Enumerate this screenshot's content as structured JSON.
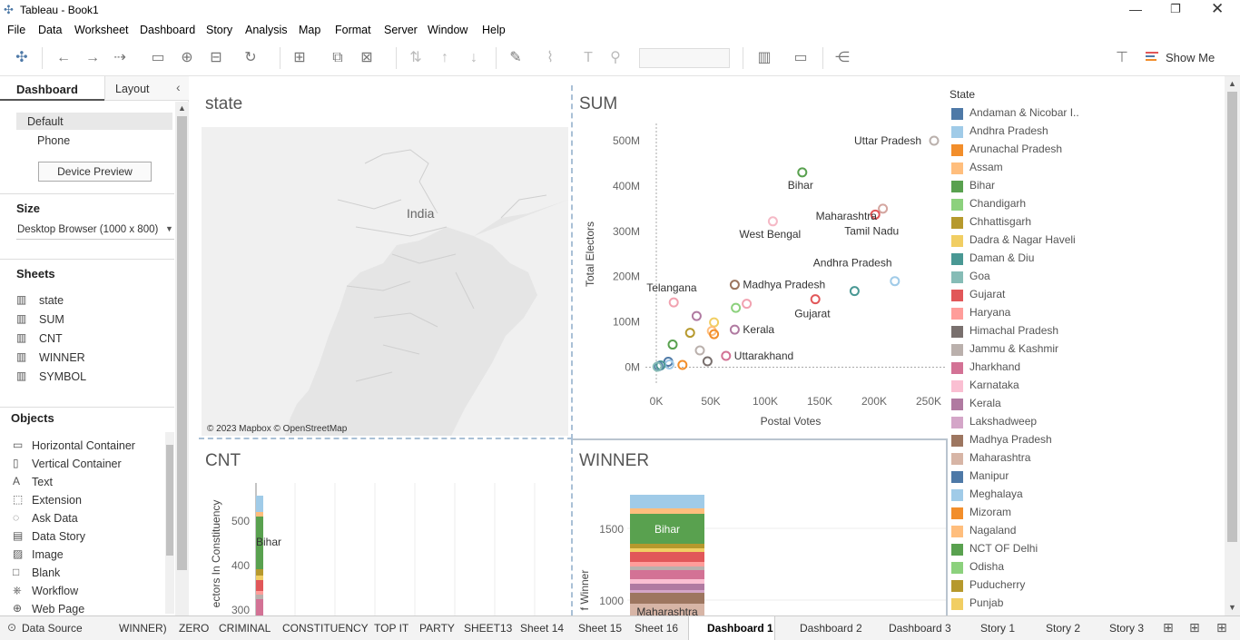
{
  "window": {
    "title": "Tableau - Book1"
  },
  "menu": [
    "File",
    "Data",
    "Worksheet",
    "Dashboard",
    "Story",
    "Analysis",
    "Map",
    "Format",
    "Server",
    "Window",
    "Help"
  ],
  "toolbar": {
    "show_me": "Show Me"
  },
  "left_panel": {
    "tabs": {
      "dashboard": "Dashboard",
      "layout": "Layout"
    },
    "device": {
      "default": "Default",
      "phone": "Phone",
      "preview_button": "Device Preview"
    },
    "size": {
      "heading": "Size",
      "value": "Desktop Browser (1000 x 800)"
    },
    "sheets": {
      "heading": "Sheets",
      "items": [
        "state",
        "SUM",
        "CNT",
        "WINNER",
        "SYMBOL"
      ]
    },
    "objects": {
      "heading": "Objects",
      "items": [
        "Horizontal Container",
        "Vertical Container",
        "Text",
        "Extension",
        "Ask Data",
        "Data Story",
        "Image",
        "Blank",
        "Workflow",
        "Web Page"
      ]
    }
  },
  "panes": {
    "map": {
      "title": "state",
      "label": "India",
      "credit": "© 2023 Mapbox © OpenStreetMap"
    },
    "sum": {
      "title": "SUM"
    },
    "cnt": {
      "title": "CNT",
      "ylabel": "ectors In Constituency",
      "yticks": [
        "500",
        "400",
        "300"
      ],
      "bar_label": "Bihar"
    },
    "winner": {
      "title": "WINNER",
      "ylabel": "f Winner",
      "yticks": [
        "1500",
        "1000"
      ],
      "bar_labels": [
        "Bihar",
        "Maharashtra"
      ]
    }
  },
  "chart_data": {
    "type": "scatter",
    "xlabel": "Postal Votes",
    "ylabel": "Total Electors",
    "xticks": [
      "0K",
      "50K",
      "100K",
      "150K",
      "200K",
      "250K"
    ],
    "yticks": [
      "0M",
      "100M",
      "200M",
      "300M",
      "400M",
      "500M"
    ],
    "xlim": [
      -10000,
      265000
    ],
    "ylim": [
      -15000000,
      530000000
    ],
    "points": [
      {
        "label": "Uttar Pradesh",
        "x": 255000,
        "y": 500000000,
        "color": "#bab0ac"
      },
      {
        "label": "Bihar",
        "x": 134000,
        "y": 430000000,
        "color": "#59a14f"
      },
      {
        "label": "Maharashtra",
        "x": 208000,
        "y": 350000000,
        "color": "#d4a6a0"
      },
      {
        "label": "Tamil Nadu",
        "x": 201000,
        "y": 337000000,
        "color": "#e15759"
      },
      {
        "label": "West Bengal",
        "x": 107000,
        "y": 322000000,
        "color": "#f5b9c6"
      },
      {
        "label": "Andhra Pradesh",
        "x": 219000,
        "y": 190000000,
        "color": "#a0cbe8"
      },
      {
        "label": "",
        "x": 182000,
        "y": 168000000,
        "color": "#499894"
      },
      {
        "label": "Madhya Pradesh",
        "x": 72000,
        "y": 182000000,
        "color": "#9c755f"
      },
      {
        "label": "Gujarat",
        "x": 146000,
        "y": 150000000,
        "color": "#e15759"
      },
      {
        "label": "Telangana",
        "x": 16000,
        "y": 143000000,
        "color": "#f1a2b0"
      },
      {
        "label": "",
        "x": 83000,
        "y": 140000000,
        "color": "#f1a2b0"
      },
      {
        "label": "",
        "x": 73000,
        "y": 131000000,
        "color": "#8cd17d"
      },
      {
        "label": "",
        "x": 37000,
        "y": 113000000,
        "color": "#b07aa1"
      },
      {
        "label": "",
        "x": 53000,
        "y": 99000000,
        "color": "#f1ce63"
      },
      {
        "label": "Kerala",
        "x": 72000,
        "y": 83000000,
        "color": "#b07aa1"
      },
      {
        "label": "",
        "x": 51000,
        "y": 80000000,
        "color": "#ffbe7d"
      },
      {
        "label": "",
        "x": 53000,
        "y": 73000000,
        "color": "#f28e2b"
      },
      {
        "label": "",
        "x": 31000,
        "y": 76000000,
        "color": "#b6992d"
      },
      {
        "label": "",
        "x": 15000,
        "y": 50000000,
        "color": "#59a14f"
      },
      {
        "label": "",
        "x": 40000,
        "y": 37000000,
        "color": "#bab0ac"
      },
      {
        "label": "Uttarakhand",
        "x": 64000,
        "y": 25000000,
        "color": "#d37295"
      },
      {
        "label": "",
        "x": 47000,
        "y": 13000000,
        "color": "#79706e"
      },
      {
        "label": "",
        "x": 24000,
        "y": 5000000,
        "color": "#f28e2b"
      },
      {
        "label": "",
        "x": 11000,
        "y": 12000000,
        "color": "#4e79a7"
      },
      {
        "label": "",
        "x": 12000,
        "y": 6000000,
        "color": "#a0cbe8"
      },
      {
        "label": "",
        "x": 4000,
        "y": 4000000,
        "color": "#499894"
      },
      {
        "label": "",
        "x": 2000,
        "y": 2000000,
        "color": "#4e79a7"
      },
      {
        "label": "",
        "x": 1000,
        "y": 1000000,
        "color": "#86bcb6"
      }
    ]
  },
  "legend": {
    "title": "State",
    "items": [
      {
        "label": "Andaman & Nicobar I..",
        "color": "#4e79a7"
      },
      {
        "label": "Andhra Pradesh",
        "color": "#a0cbe8"
      },
      {
        "label": "Arunachal Pradesh",
        "color": "#f28e2b"
      },
      {
        "label": "Assam",
        "color": "#ffbe7d"
      },
      {
        "label": "Bihar",
        "color": "#59a14f"
      },
      {
        "label": "Chandigarh",
        "color": "#8cd17d"
      },
      {
        "label": "Chhattisgarh",
        "color": "#b6992d"
      },
      {
        "label": "Dadra & Nagar Haveli",
        "color": "#f1ce63"
      },
      {
        "label": "Daman & Diu",
        "color": "#499894"
      },
      {
        "label": "Goa",
        "color": "#86bcb6"
      },
      {
        "label": "Gujarat",
        "color": "#e15759"
      },
      {
        "label": "Haryana",
        "color": "#ff9d9a"
      },
      {
        "label": "Himachal Pradesh",
        "color": "#79706e"
      },
      {
        "label": "Jammu & Kashmir",
        "color": "#bab0ac"
      },
      {
        "label": "Jharkhand",
        "color": "#d37295"
      },
      {
        "label": "Karnataka",
        "color": "#fabfd2"
      },
      {
        "label": "Kerala",
        "color": "#b07aa1"
      },
      {
        "label": "Lakshadweep",
        "color": "#d4a6c8"
      },
      {
        "label": "Madhya Pradesh",
        "color": "#9d7660"
      },
      {
        "label": "Maharashtra",
        "color": "#d7b5a6"
      },
      {
        "label": "Manipur",
        "color": "#4e79a7"
      },
      {
        "label": "Meghalaya",
        "color": "#a0cbe8"
      },
      {
        "label": "Mizoram",
        "color": "#f28e2b"
      },
      {
        "label": "Nagaland",
        "color": "#ffbe7d"
      },
      {
        "label": "NCT OF Delhi",
        "color": "#59a14f"
      },
      {
        "label": "Odisha",
        "color": "#8cd17d"
      },
      {
        "label": "Puducherry",
        "color": "#b6992d"
      },
      {
        "label": "Punjab",
        "color": "#f1ce63"
      }
    ]
  },
  "bottom_tabs": [
    "Data Source",
    "WINNER)",
    "ZERO",
    "CRIMINAL",
    "CONSTITUENCY",
    "TOP IT",
    "PARTY",
    "SHEET13",
    "Sheet 14",
    "Sheet 15",
    "Sheet 16",
    "Dashboard 1",
    "Dashboard 2",
    "Dashboard 3",
    "Story 1",
    "Story 2",
    "Story 3"
  ]
}
